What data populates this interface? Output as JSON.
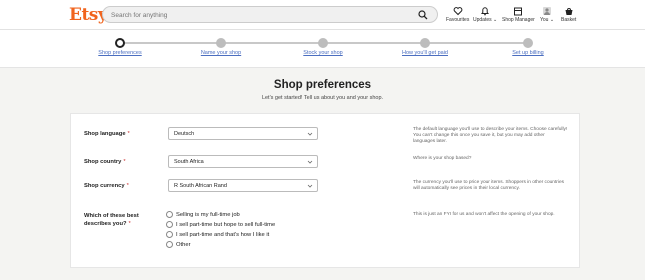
{
  "header": {
    "logo": "Etsy",
    "search_placeholder": "Search for anything",
    "nav": [
      {
        "label": "Favourites",
        "icon": "heart-icon"
      },
      {
        "label": "Updates",
        "icon": "bell-icon"
      },
      {
        "label": "Shop Manager",
        "icon": "shop-icon"
      },
      {
        "label": "You",
        "icon": "avatar-icon"
      },
      {
        "label": "Basket",
        "icon": "basket-icon"
      }
    ]
  },
  "steps": [
    {
      "label": "Shop preferences",
      "active": true
    },
    {
      "label": "Name your shop",
      "active": false
    },
    {
      "label": "Stock your shop",
      "active": false
    },
    {
      "label": "How you'll get paid",
      "active": false
    },
    {
      "label": "Set up billing",
      "active": false
    }
  ],
  "page": {
    "title": "Shop preferences",
    "subtitle": "Let's get started! Tell us about you and your shop."
  },
  "form": {
    "language": {
      "label": "Shop language",
      "required": "*",
      "value": "Deutsch",
      "help": "The default language you'll use to describe your items. Choose carefully! You can't change this once you save it, but you may add other languages later."
    },
    "country": {
      "label": "Shop country",
      "required": "*",
      "value": "South Africa",
      "help": "Where is your shop based?"
    },
    "currency": {
      "label": "Shop currency",
      "required": "*",
      "value": "R South African Rand",
      "help": "The currency you'll use to price your items. Shoppers in other countries will automatically see prices in their local currency."
    },
    "describe": {
      "label_line1": "Which of these best",
      "label_line2": "describes you?",
      "required": "*",
      "options": [
        "Selling is my full-time job",
        "I sell part-time but hope to sell full-time",
        "I sell part-time and that's how I like it",
        "Other"
      ],
      "help": "This is just an FYI for us and won't affect the opening of your shop."
    }
  },
  "colors": {
    "brand": "#f1641e",
    "link": "#4b6ec0",
    "required": "#cc3333"
  }
}
